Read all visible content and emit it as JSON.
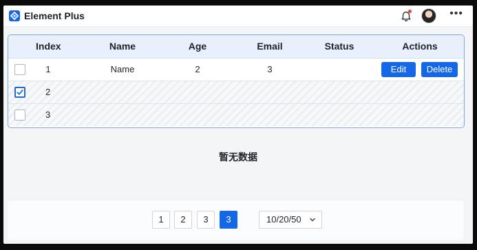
{
  "app": {
    "title": "Element Plus"
  },
  "header": {
    "icons": {
      "bell": "bell-icon",
      "avatar": "user-avatar",
      "more": "more-horizontal-icon"
    },
    "notification_dot_color": "#f23c3c"
  },
  "table": {
    "columns": [
      "Index",
      "Name",
      "Age",
      "Email",
      "Status",
      "Actions"
    ],
    "rows": [
      {
        "checked": false,
        "index": "1",
        "name": "Name",
        "age": "2",
        "email": "3",
        "status": ""
      },
      {
        "checked": true,
        "index": "2",
        "name": "",
        "age": "",
        "email": "",
        "status": ""
      },
      {
        "checked": false,
        "index": "3",
        "name": "",
        "age": "",
        "email": "",
        "status": ""
      }
    ],
    "actions": {
      "edit": "Edit",
      "delete": "Delete"
    }
  },
  "empty_text": "暂无数据",
  "pagination": {
    "pages": [
      "1",
      "2",
      "3",
      "3"
    ],
    "active_page_index": 3,
    "page_size_label": "10/20/50"
  },
  "colors": {
    "primary": "#1467e6",
    "header_bg": "#e7f0fc",
    "table_border": "#79a8e6"
  }
}
